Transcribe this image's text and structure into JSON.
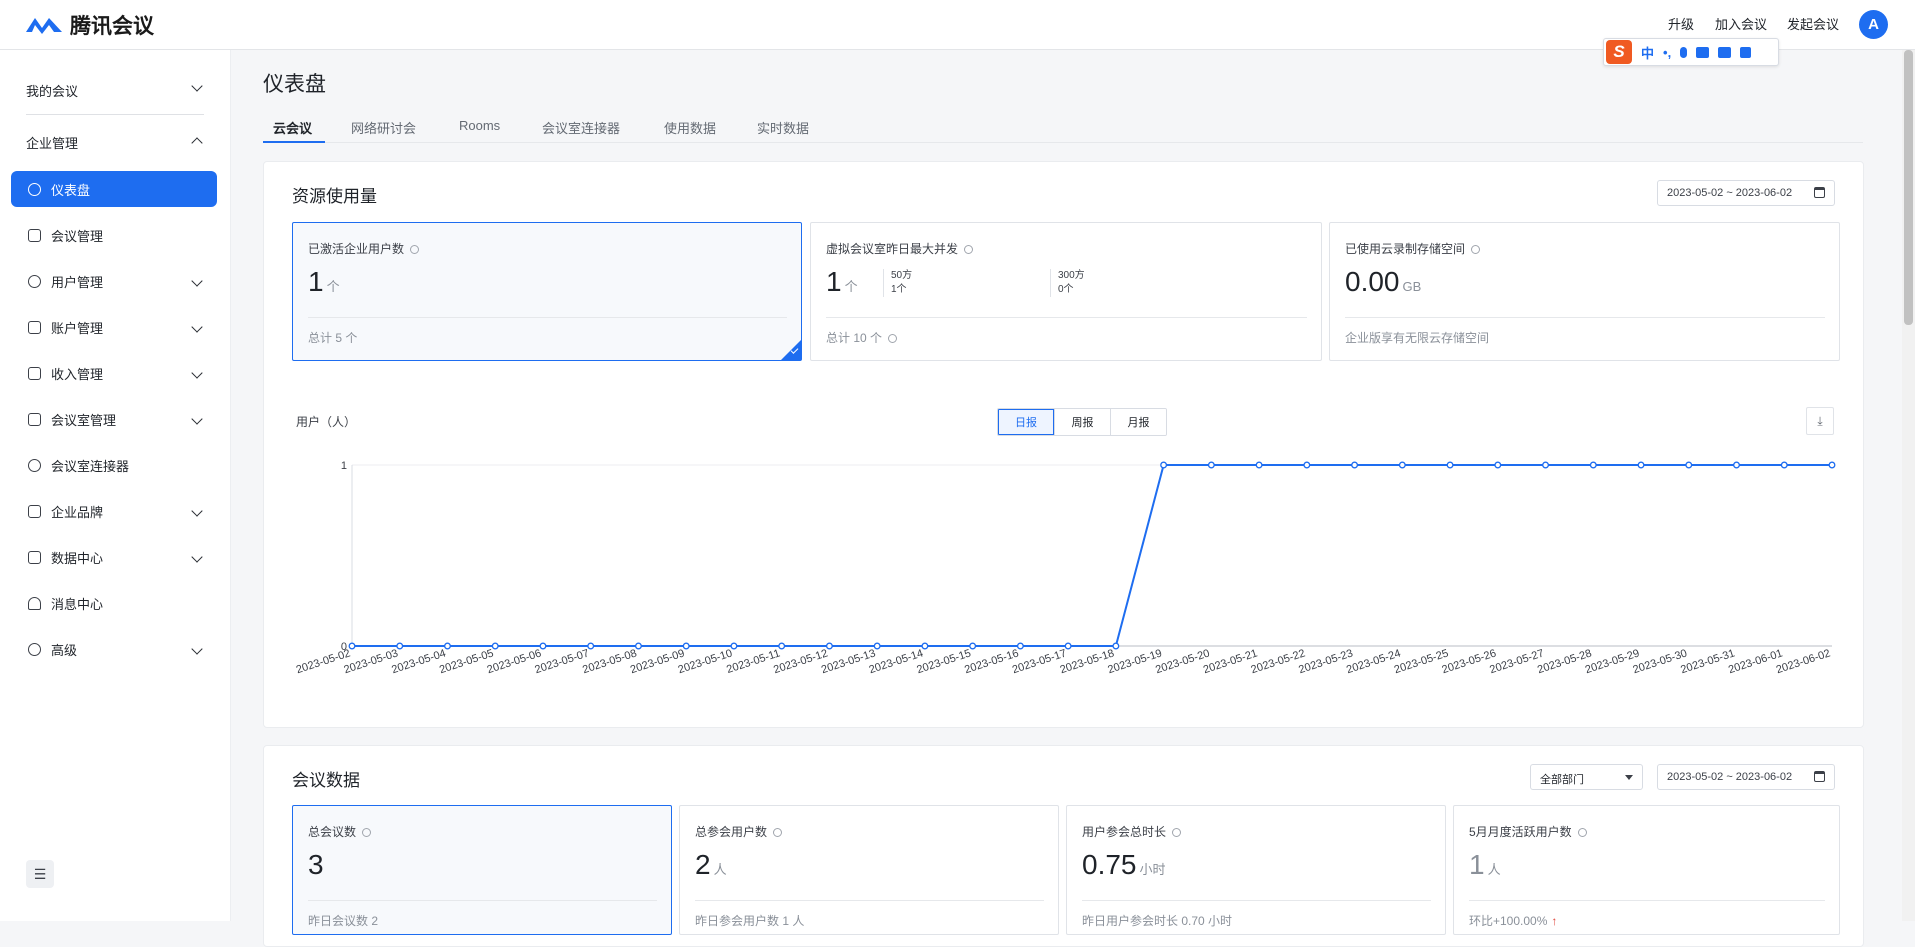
{
  "app": {
    "name": "腾讯会议"
  },
  "topnav": {
    "upgrade": "升级",
    "join": "加入会议",
    "start": "发起会议",
    "avatar": "A"
  },
  "ime": {
    "s": "S",
    "zh": "中",
    "punct": "•,"
  },
  "sidebar": {
    "groups": [
      {
        "label": "我的会议",
        "expanded": false
      },
      {
        "label": "企业管理",
        "expanded": true
      }
    ],
    "items": [
      {
        "label": "仪表盘",
        "icon": "dashboard-icon",
        "active": true,
        "has_children": false
      },
      {
        "label": "会议管理",
        "icon": "meeting-list-icon",
        "active": false,
        "has_children": false
      },
      {
        "label": "用户管理",
        "icon": "user-icon",
        "active": false,
        "has_children": true
      },
      {
        "label": "账户管理",
        "icon": "account-icon",
        "active": false,
        "has_children": true
      },
      {
        "label": "收入管理",
        "icon": "income-icon",
        "active": false,
        "has_children": true
      },
      {
        "label": "会议室管理",
        "icon": "meeting-room-icon",
        "active": false,
        "has_children": true
      },
      {
        "label": "会议室连接器",
        "icon": "link-icon",
        "active": false,
        "has_children": false
      },
      {
        "label": "企业品牌",
        "icon": "brand-icon",
        "active": false,
        "has_children": true
      },
      {
        "label": "数据中心",
        "icon": "data-center-icon",
        "active": false,
        "has_children": true
      },
      {
        "label": "消息中心",
        "icon": "bell-icon",
        "active": false,
        "has_children": false
      },
      {
        "label": "高级",
        "icon": "advanced-icon",
        "active": false,
        "has_children": true
      }
    ]
  },
  "page": {
    "title": "仪表盘"
  },
  "tabs": [
    {
      "label": "云会议",
      "active": true
    },
    {
      "label": "网络研讨会",
      "active": false
    },
    {
      "label": "Rooms",
      "active": false
    },
    {
      "label": "会议室连接器",
      "active": false
    },
    {
      "label": "使用数据",
      "active": false
    },
    {
      "label": "实时数据",
      "active": false
    }
  ],
  "resource": {
    "title": "资源使用量",
    "date_range": "2023-05-02 ~ 2023-06-02",
    "cards": [
      {
        "label": "已激活企业用户数",
        "value": "1",
        "unit": "个",
        "foot": "总计 5 个"
      },
      {
        "label": "虚拟会议室昨日最大并发",
        "value": "1",
        "unit": "个",
        "foot": "总计 10 个",
        "sub": [
          {
            "top": "50方",
            "bottom": "1个"
          },
          {
            "top": "300方",
            "bottom": "0个"
          }
        ]
      },
      {
        "label": "已使用云录制存储空间",
        "value": "0.00",
        "unit": "GB",
        "foot": "企业版享有无限云存储空间"
      }
    ],
    "chart_controls": {
      "ylabel": "用户（人）",
      "daily": "日报",
      "weekly": "周报",
      "monthly": "月报"
    }
  },
  "chart_data": {
    "type": "line",
    "title": "",
    "ylabel": "用户（人）",
    "ylim": [
      0,
      1
    ],
    "yticks": [
      "0",
      "1"
    ],
    "x": [
      "2023-05-02",
      "2023-05-03",
      "2023-05-04",
      "2023-05-05",
      "2023-05-06",
      "2023-05-07",
      "2023-05-08",
      "2023-05-09",
      "2023-05-10",
      "2023-05-11",
      "2023-05-12",
      "2023-05-13",
      "2023-05-14",
      "2023-05-15",
      "2023-05-16",
      "2023-05-17",
      "2023-05-18",
      "2023-05-19",
      "2023-05-20",
      "2023-05-21",
      "2023-05-22",
      "2023-05-23",
      "2023-05-24",
      "2023-05-25",
      "2023-05-26",
      "2023-05-27",
      "2023-05-28",
      "2023-05-29",
      "2023-05-30",
      "2023-05-31",
      "2023-06-01",
      "2023-06-02"
    ],
    "series": [
      {
        "values": [
          0,
          0,
          0,
          0,
          0,
          0,
          0,
          0,
          0,
          0,
          0,
          0,
          0,
          0,
          0,
          0,
          0,
          1,
          1,
          1,
          1,
          1,
          1,
          1,
          1,
          1,
          1,
          1,
          1,
          1,
          1,
          1
        ],
        "color": "#1e6df0"
      }
    ]
  },
  "meeting": {
    "title": "会议数据",
    "department": "全部部门",
    "date_range": "2023-05-02 ~ 2023-06-02",
    "cards": [
      {
        "label": "总会议数",
        "value": "3",
        "unit": "",
        "foot": "昨日会议数 2"
      },
      {
        "label": "总参会用户数",
        "value": "2",
        "unit": "人",
        "foot": "昨日参会用户数 1 人"
      },
      {
        "label": "用户参会总时长",
        "value": "0.75",
        "unit": "小时",
        "foot": "昨日用户参会时长 0.70 小时"
      },
      {
        "label": "5月月度活跃用户数",
        "value": "1",
        "unit": "人",
        "foot": "环比+100.00%"
      }
    ]
  },
  "colors": {
    "accent": "#1e6df0",
    "text": "#1f2329",
    "muted": "#8a9099"
  }
}
